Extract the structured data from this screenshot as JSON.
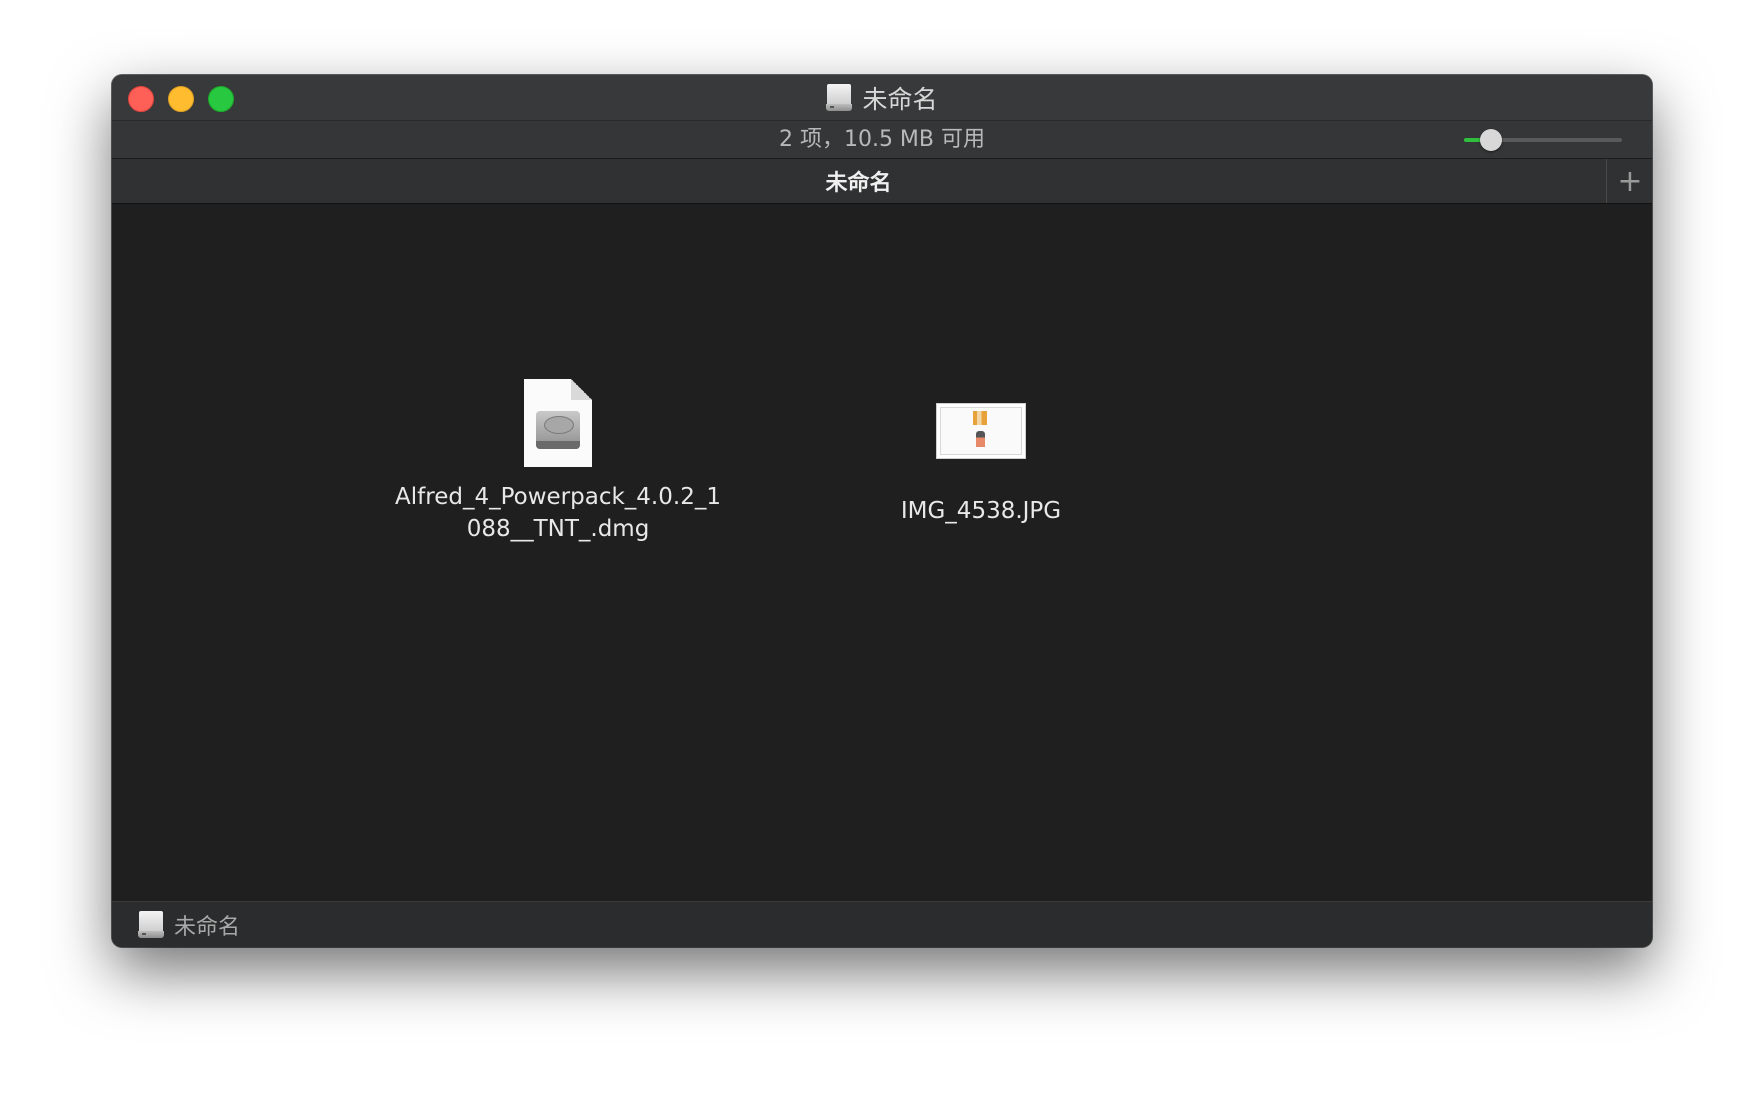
{
  "window": {
    "title": "未命名",
    "title_icon": "external-disk-icon"
  },
  "status": {
    "text": "2 项，10.5 MB 可用",
    "icon_size_fraction": 0.17
  },
  "tabs": [
    {
      "label": "未命名",
      "active": true
    }
  ],
  "tab_add_icon": "plus-icon",
  "files": [
    {
      "name_line1": "Alfred_4_Powerpack_4.0.2_1",
      "name_line2": "088__TNT_.dmg",
      "icon": "disk-image-document-icon"
    },
    {
      "name_line1": "IMG_4538.JPG",
      "icon": "image-thumbnail-icon"
    }
  ],
  "pathbar": {
    "label": "未命名",
    "icon": "external-disk-icon"
  },
  "colors": {
    "close": "#fe5f57",
    "minimize": "#febc2e",
    "maximize": "#28c840",
    "slider_fill": "#2fbf3c",
    "background": "#1f1f1f"
  }
}
